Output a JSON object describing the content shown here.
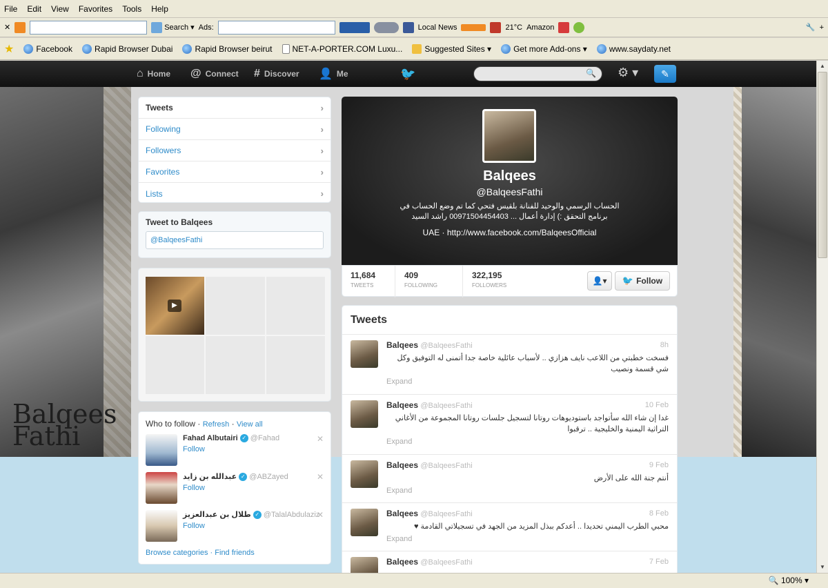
{
  "browser": {
    "menu": [
      "File",
      "Edit",
      "View",
      "Favorites",
      "Tools",
      "Help"
    ],
    "toolbar": {
      "search_label": "Search",
      "ads_label": "Ads:",
      "local_news": "Local News",
      "temperature": "21°C",
      "amazon": "Amazon"
    },
    "favorites": [
      "Facebook",
      "Rapid Browser Dubai",
      "Rapid Browser beirut",
      "NET-A-PORTER.COM  Luxu...",
      "Suggested Sites ▾",
      "Get more Add-ons ▾",
      "www.saydaty.net"
    ],
    "zoom": "100%"
  },
  "twitter_nav": {
    "home": "Home",
    "connect": "Connect",
    "discover": "Discover",
    "me": "Me"
  },
  "sidebar": {
    "items": [
      {
        "label": "Tweets"
      },
      {
        "label": "Following"
      },
      {
        "label": "Followers"
      },
      {
        "label": "Favorites"
      },
      {
        "label": "Lists"
      }
    ],
    "tweet_to_title": "Tweet to Balqees",
    "tweet_to_value": "@BalqeesFathi",
    "who_to_follow": "Who to follow",
    "refresh": "Refresh",
    "view_all": "View all",
    "suggestions": [
      {
        "name": "Fahad Albutairi",
        "handle": "@Fahad",
        "follow": "Follow"
      },
      {
        "name": "عبدالله بن زايد",
        "handle": "@ABZayed",
        "follow": "Follow"
      },
      {
        "name": "طلال بن عبدالعزيز",
        "handle": "@TalalAbdulaziz",
        "follow": "Follow"
      }
    ],
    "browse_categories": "Browse categories",
    "find_friends": "Find friends"
  },
  "background": {
    "signature": "Balqees Fathi"
  },
  "profile": {
    "name": "Balqees",
    "handle": "@BalqeesFathi",
    "bio": "الحساب الرسمي والوحيد للفنانة بلقيس فتحي كما تم وضع الحساب في برنامج التحقق :) إدارة أعمال ... 00971504454403 راشد السيد",
    "location": "UAE · http://www.facebook.com/BalqeesOfficial",
    "stats": [
      {
        "value": "11,684",
        "label": "TWEETS"
      },
      {
        "value": "409",
        "label": "FOLLOWING"
      },
      {
        "value": "322,195",
        "label": "FOLLOWERS"
      }
    ],
    "follow_label": "Follow"
  },
  "stream": {
    "title": "Tweets",
    "expand": "Expand",
    "tweets": [
      {
        "name": "Balqees",
        "handle": "@BalqeesFathi",
        "time": "8h",
        "text": "فسخت خطبتي من اللاعب نايف هزازي .. لأسباب عائلية خاصة جدا أتمنى له التوفيق وكل شي قسمة ونصيب"
      },
      {
        "name": "Balqees",
        "handle": "@BalqeesFathi",
        "time": "10 Feb",
        "text": "غدا إن شاء الله سأتواجد باستوديوهات روتانا لتسجيل جلسات روتانا المجموعة من الأغاني التراثية اليمنية والخليجية .. ترقبوا"
      },
      {
        "name": "Balqees",
        "handle": "@BalqeesFathi",
        "time": "9 Feb",
        "text": "أنتم جنة الله على الأرض"
      },
      {
        "name": "Balqees",
        "handle": "@BalqeesFathi",
        "time": "8 Feb",
        "text": "محبي الطرب اليمني تحديدا .. أعدكم ببذل المزيد من الجهد في تسجيلاتي القادمة ♥"
      },
      {
        "name": "Balqees",
        "handle": "@BalqeesFathi",
        "time": "7 Feb",
        "text": ""
      }
    ]
  },
  "colors": {
    "link": "#2e8bc9",
    "bar": "#1b1b1b",
    "accent": "#2aa9e0"
  }
}
